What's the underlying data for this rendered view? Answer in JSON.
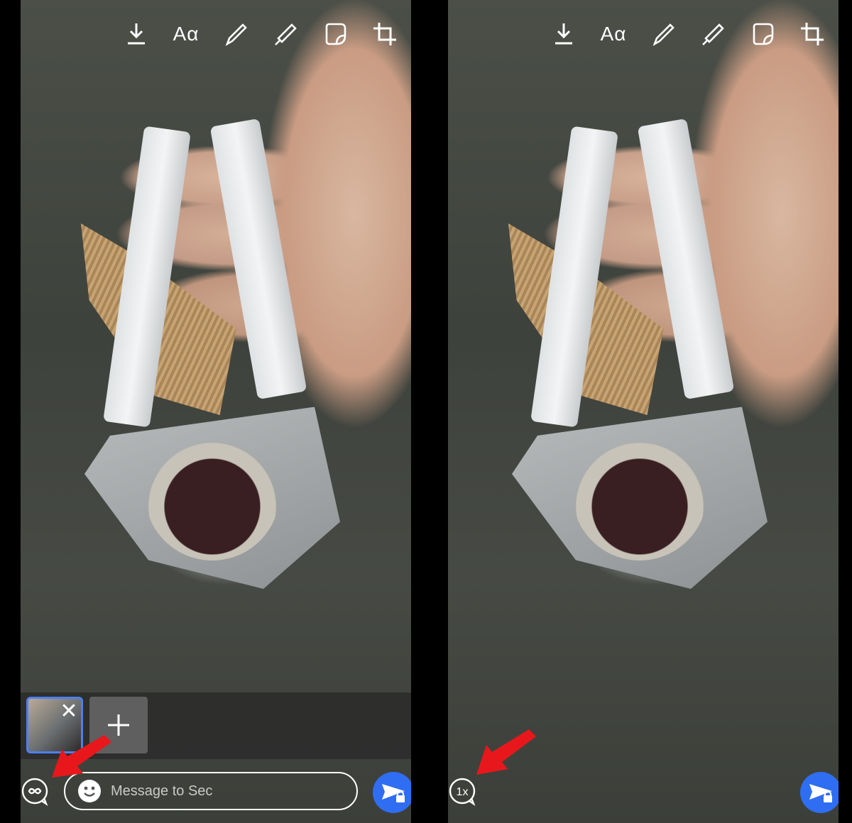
{
  "panels": [
    {
      "toolbar": {
        "download_icon": "download-icon",
        "text_label": "Aα",
        "pen_icon": "pen-icon",
        "marker_icon": "marker-icon",
        "sticker_icon": "sticker-icon",
        "crop_icon": "crop-icon"
      },
      "footer": {
        "loop_icon": "infinity-loop-icon",
        "message_placeholder": "Message to Sec",
        "emoji_icon": "emoji-icon",
        "send_icon": "send-secure-icon"
      }
    },
    {
      "toolbar": {
        "text_label": "Aα"
      },
      "footer": {
        "loop_label": "1x",
        "send_icon": "send-secure-icon"
      }
    }
  ],
  "colors": {
    "accent": "#2f6ef2",
    "annotation_arrow": "#e8171c",
    "thumbnail_border": "#4d7ff0"
  }
}
